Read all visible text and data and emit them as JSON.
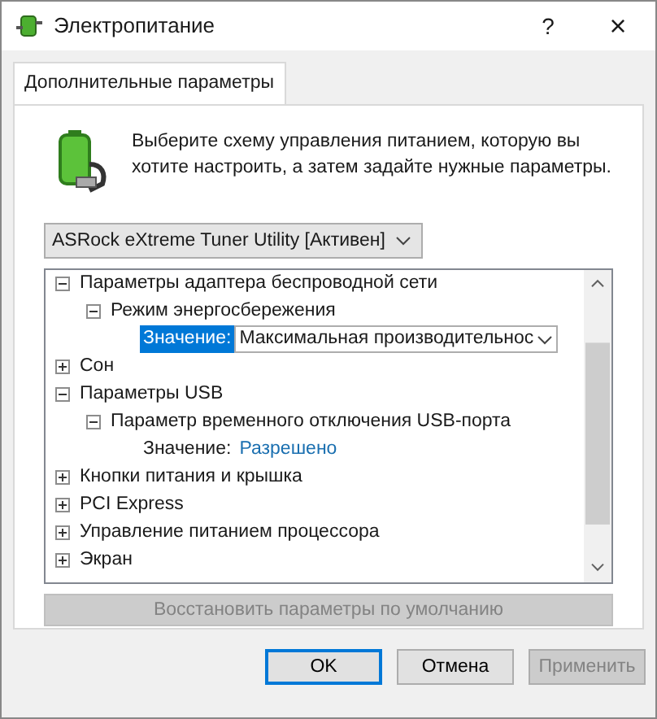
{
  "window": {
    "title": "Электропитание",
    "help": "?",
    "close": "×"
  },
  "tabs": [
    {
      "label": "Дополнительные параметры",
      "selected": true
    }
  ],
  "intro": "Выберите схему управления питанием, которую вы хотите настроить, а затем задайте нужные параметры.",
  "scheme": {
    "value": "ASRock eXtreme Tuner Utility [Активен]"
  },
  "tree": [
    {
      "kind": "group",
      "label": "Параметры адаптера беспроводной сети",
      "expanded": true,
      "children": [
        {
          "kind": "group",
          "label": "Режим энергосбережения",
          "expanded": true,
          "children": [
            {
              "kind": "dropdown",
              "label": "Значение:",
              "value": "Максимальная производительнос",
              "selected": true
            }
          ]
        }
      ]
    },
    {
      "kind": "group",
      "label": "Сон",
      "expanded": false
    },
    {
      "kind": "group",
      "label": "Параметры USB",
      "expanded": true,
      "children": [
        {
          "kind": "group",
          "label": "Параметр временного отключения USB-порта",
          "expanded": true,
          "children": [
            {
              "kind": "link",
              "label": "Значение:",
              "value": "Разрешено",
              "selected": false
            }
          ]
        }
      ]
    },
    {
      "kind": "group",
      "label": "Кнопки питания и крышка",
      "expanded": false
    },
    {
      "kind": "group",
      "label": "PCI Express",
      "expanded": false
    },
    {
      "kind": "group",
      "label": "Управление питанием процессора",
      "expanded": false
    },
    {
      "kind": "group",
      "label": "Экран",
      "expanded": false
    }
  ],
  "restore_button": {
    "label": "Восстановить параметры по умолчанию",
    "disabled": true
  },
  "buttons": [
    {
      "label": "OK",
      "disabled": false,
      "default": true
    },
    {
      "label": "Отмена",
      "disabled": false,
      "default": false
    },
    {
      "label": "Применить",
      "disabled": true,
      "default": false
    }
  ]
}
